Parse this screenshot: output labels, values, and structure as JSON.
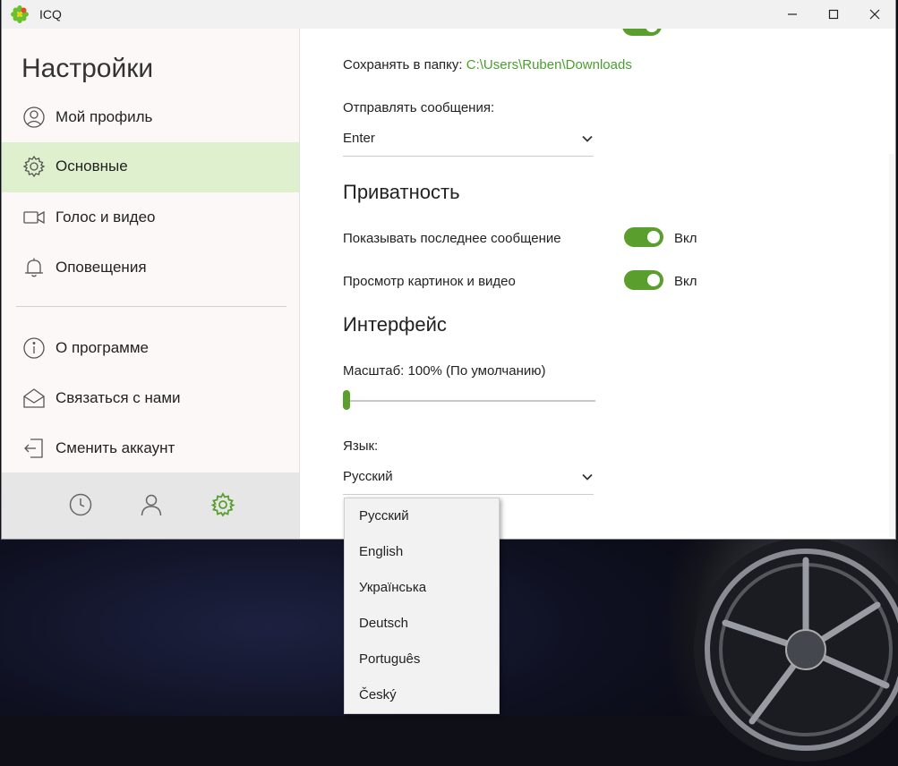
{
  "app": {
    "title": "ICQ",
    "accent": "#5a9f2e",
    "active_bg": "#dff0cf"
  },
  "window_controls": {
    "minimize": "—",
    "maximize": "☐",
    "close": "✕"
  },
  "sidebar": {
    "title": "Настройки",
    "items": [
      {
        "label": "Мой профиль",
        "icon": "user-circle-icon"
      },
      {
        "label": "Основные",
        "icon": "gear-icon",
        "active": true
      },
      {
        "label": "Голос и видео",
        "icon": "video-camera-icon"
      },
      {
        "label": "Оповещения",
        "icon": "bell-icon"
      },
      {
        "label": "О программе",
        "icon": "info-icon"
      },
      {
        "label": "Связаться с нами",
        "icon": "envelope-icon"
      },
      {
        "label": "Сменить аккаунт",
        "icon": "logout-icon"
      }
    ],
    "bottom_tabs": [
      {
        "icon": "clock-icon"
      },
      {
        "icon": "contact-icon"
      },
      {
        "icon": "settings-gear-icon",
        "active": true
      }
    ]
  },
  "settings": {
    "save_folder_label": "Сохранять в папку:",
    "save_folder_path": "C:\\Users\\Ruben\\Downloads",
    "send_messages_label": "Отправлять сообщения:",
    "send_messages_value": "Enter",
    "privacy_title": "Приватность",
    "show_last_message_label": "Показывать последнее сообщение",
    "show_last_message_state": "Вкл",
    "preview_media_label": "Просмотр картинок и видео",
    "preview_media_state": "Вкл",
    "interface_title": "Интерфейс",
    "scale_label": "Масштаб: 100% (По умолчанию)",
    "scale_level": 0,
    "language_label": "Язык:",
    "language_value": "Русский"
  },
  "language_dropdown": {
    "options": [
      "Русский",
      "English",
      "Українська",
      "Deutsch",
      "Português",
      "Český"
    ]
  }
}
